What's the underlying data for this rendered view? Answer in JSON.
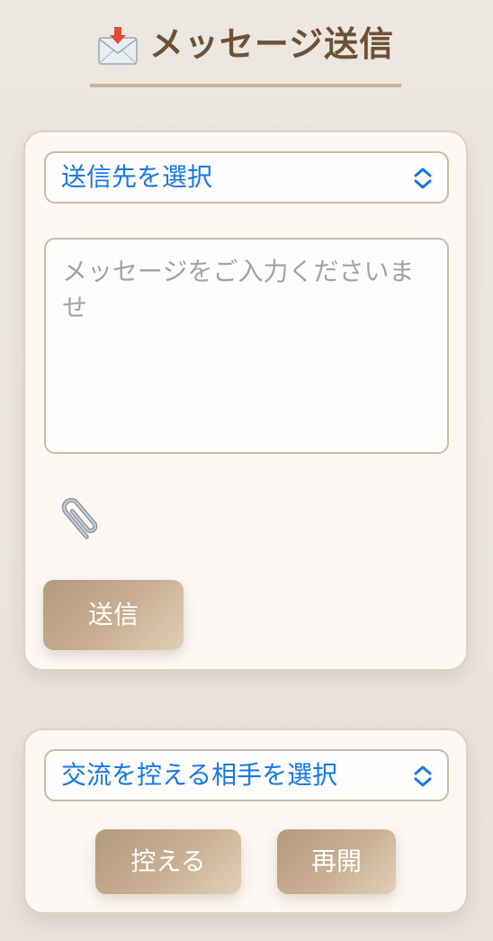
{
  "header": {
    "title": "メッセージ送信",
    "icon": "envelope-incoming-icon"
  },
  "send_form": {
    "recipient_select": {
      "selected": "送信先を選択"
    },
    "message_input": {
      "placeholder": "メッセージをご入力くださいませ",
      "value": ""
    },
    "attach_icon": "paperclip-icon",
    "send_label": "送信"
  },
  "block_form": {
    "target_select": {
      "selected": "交流を控える相手を選択"
    },
    "block_label": "控える",
    "resume_label": "再開"
  },
  "colors": {
    "accent": "#1677e6",
    "title": "#6e5136",
    "button_start": "#b59b7d",
    "button_end": "#e3cfb8",
    "card_bg": "#fdf8f4"
  }
}
